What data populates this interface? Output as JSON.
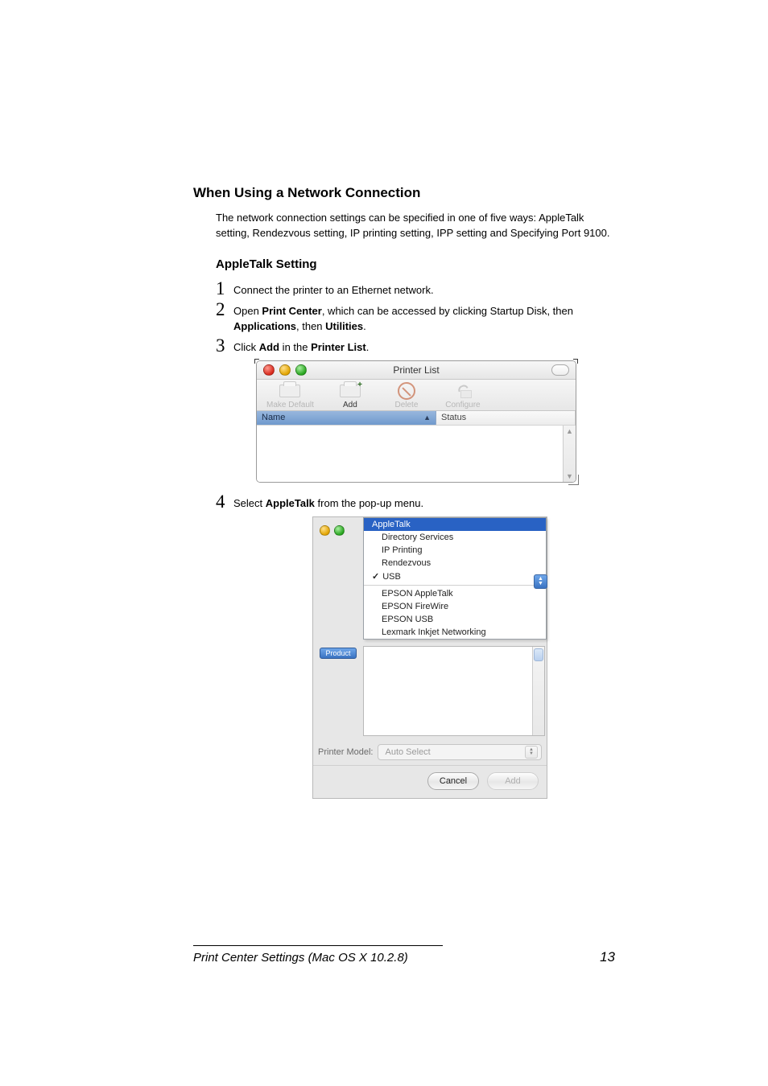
{
  "main": {
    "heading": "When Using a Network Connection",
    "intro": "The network connection settings can be specified in one of five ways: AppleTalk setting, Rendezvous setting, IP printing setting, IPP setting and Specifying Port 9100.",
    "subheading": "AppleTalk Setting"
  },
  "steps": {
    "s1": {
      "num": "1",
      "text": "Connect the printer to an Ethernet network."
    },
    "s2": {
      "num": "2",
      "t1": "Open ",
      "b1": "Print Center",
      "t2": ", which can be accessed by clicking Startup Disk, then ",
      "b2": "Applications",
      "t3": ", then ",
      "b3": "Utilities",
      "t4": "."
    },
    "s3": {
      "num": "3",
      "t1": "Click ",
      "b1": "Add",
      "t2": " in the ",
      "b2": "Printer List",
      "t3": "."
    },
    "s4": {
      "num": "4",
      "t1": "Select ",
      "b1": "AppleTalk",
      "t2": " from the pop-up menu."
    }
  },
  "win1": {
    "title": "Printer List",
    "tb_makeDefault": "Make Default",
    "tb_add": "Add",
    "tb_delete": "Delete",
    "tb_configure": "Configure",
    "col_name": "Name",
    "col_status": "Status"
  },
  "win2": {
    "menu": {
      "appleTalk": "AppleTalk",
      "directoryServices": "Directory Services",
      "ipPrinting": "IP Printing",
      "rendezvous": "Rendezvous",
      "usb": "USB",
      "epsonAppleTalk": "EPSON AppleTalk",
      "epsonFireWire": "EPSON FireWire",
      "epsonUsb": "EPSON USB",
      "lexmark": "Lexmark Inkjet Networking"
    },
    "productBtn": "Product",
    "printerModelLabel": "Printer Model:",
    "printerModelValue": "Auto Select",
    "cancel": "Cancel",
    "add": "Add"
  },
  "footer": {
    "title": "Print Center Settings (Mac OS X 10.2.8)",
    "page": "13"
  }
}
